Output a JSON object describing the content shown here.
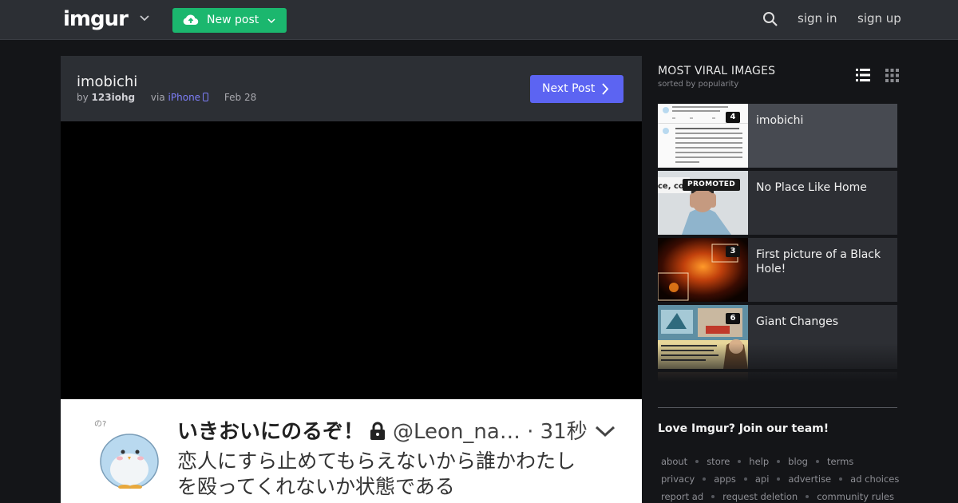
{
  "header": {
    "logo_text": "imgur",
    "new_post_label": "New post",
    "sign_in_label": "sign in",
    "sign_up_label": "sign up"
  },
  "post": {
    "title": "imobichi",
    "by_label": "by",
    "author": "123iohg",
    "via_label": "via",
    "via_device": "iPhone",
    "date": "Feb 28",
    "next_post_label": "Next Post"
  },
  "post_image": {
    "display_name": "いきおいにのるぞ！",
    "handle": "@Leon_na… · 31秒",
    "body_line_1": "恋人にすら止めてもらえないから誰かわたし",
    "body_line_2": "を殴ってくれないか状態である"
  },
  "sidebar": {
    "heading": "MOST VIRAL IMAGES",
    "subheading": "sorted by popularity",
    "items": [
      {
        "title": "imobichi",
        "badge": "4",
        "active": true
      },
      {
        "title": "No Place Like Home",
        "badge": "PROMOTED",
        "active": false
      },
      {
        "title": "First picture of a Black Hole!",
        "badge": "3",
        "active": false
      },
      {
        "title": "Giant Changes",
        "badge": "6",
        "active": false
      }
    ],
    "join_text": "Love Imgur? Join our team!",
    "footer_links": [
      [
        "about",
        "store",
        "help",
        "blog",
        "terms"
      ],
      [
        "privacy",
        "apps",
        "api",
        "advertise",
        "ad choices"
      ],
      [
        "report ad",
        "request deletion",
        "community rules"
      ]
    ]
  },
  "colors": {
    "topbar_bg": "#2c2f34",
    "page_bg": "#141518",
    "new_post_green": "#1bb76e",
    "next_post_purple": "#5c64f2",
    "link_purple": "#7d7ef8"
  }
}
